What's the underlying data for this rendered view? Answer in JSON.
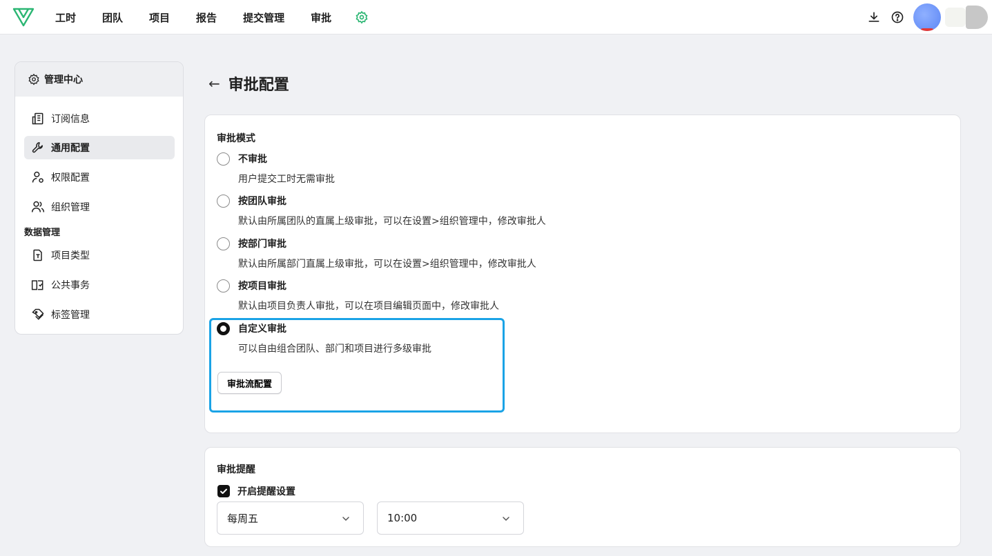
{
  "topnav": {
    "items": [
      "工时",
      "团队",
      "项目",
      "报告",
      "提交管理",
      "审批"
    ],
    "accent_color": "#2bb673"
  },
  "sidebar": {
    "header": "管理中心",
    "items": [
      {
        "label": "订阅信息",
        "icon": "building-icon"
      },
      {
        "label": "通用配置",
        "icon": "wrench-icon",
        "active": true
      },
      {
        "label": "权限配置",
        "icon": "user-gear-icon"
      },
      {
        "label": "组织管理",
        "icon": "users-icon"
      }
    ],
    "section": "数据管理",
    "section_items": [
      {
        "label": "项目类型",
        "icon": "file-icon"
      },
      {
        "label": "公共事务",
        "icon": "book-icon"
      },
      {
        "label": "标签管理",
        "icon": "tag-icon"
      }
    ]
  },
  "page": {
    "back": "←",
    "title": "审批配置"
  },
  "approval_mode": {
    "title": "审批模式",
    "options": [
      {
        "label": "不审批",
        "desc": "用户提交工时无需审批",
        "checked": false
      },
      {
        "label": "按团队审批",
        "desc": "默认由所属团队的直属上级审批，可以在设置>组织管理中，修改审批人",
        "checked": false
      },
      {
        "label": "按部门审批",
        "desc": "默认由所属部门直属上级审批，可以在设置>组织管理中，修改审批人",
        "checked": false
      },
      {
        "label": "按项目审批",
        "desc": "默认由项目负责人审批，可以在项目编辑页面中，修改审批人",
        "checked": false
      },
      {
        "label": "自定义审批",
        "desc": "可以自由组合团队、部门和项目进行多级审批",
        "checked": true
      }
    ],
    "flow_button": "审批流配置",
    "highlight_color": "#1aa3e6"
  },
  "reminder": {
    "title": "审批提醒",
    "checkbox_label": "开启提醒设置",
    "checked": true,
    "day_value": "每周五",
    "time_value": "10:00"
  }
}
